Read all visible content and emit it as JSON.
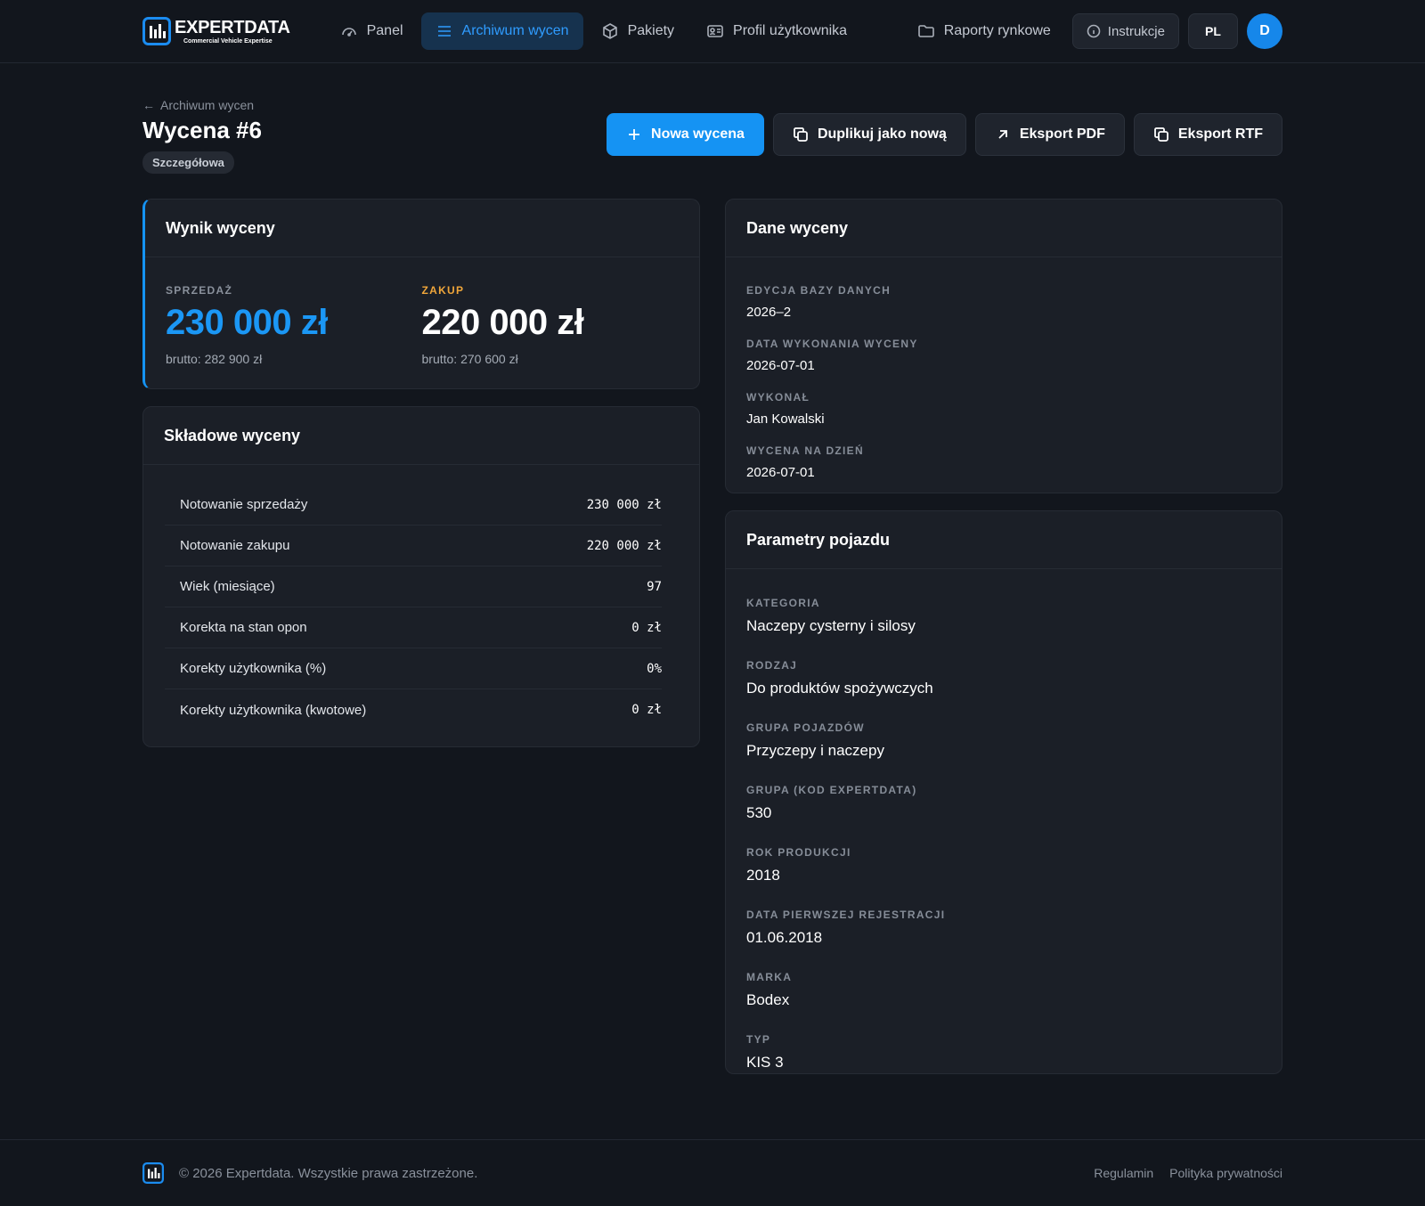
{
  "brand": {
    "name": "EXPERTDATA",
    "tagline": "Commercial Vehicle Expertise",
    "accent": "#1593f3"
  },
  "nav": {
    "items": [
      {
        "label": "Panel",
        "icon": "gauge-icon",
        "active": false
      },
      {
        "label": "Archiwum wycen",
        "icon": "menu-icon",
        "active": true
      },
      {
        "label": "Pakiety",
        "icon": "package-icon",
        "active": false
      },
      {
        "label": "Profil użytkownika",
        "icon": "id-card-icon",
        "active": false
      }
    ],
    "reports_label": "Raporty rynkowe",
    "instructions_label": "Instrukcje",
    "language": "PL",
    "avatar_initial": "D"
  },
  "header": {
    "back_label": "Archiwum wycen",
    "title": "Wycena #6",
    "badge": "Szczegółowa"
  },
  "actions": {
    "new_label": "Nowa wycena",
    "duplicate_label": "Duplikuj jako nową",
    "pdf_label": "Eksport PDF",
    "rtf_label": "Eksport RTF"
  },
  "result": {
    "title": "Wynik wyceny",
    "sale_label": "SPRZEDAŻ",
    "sale_value": "230 000 zł",
    "sale_gross": "brutto: 282 900 zł",
    "buy_label": "ZAKUP",
    "buy_value": "220 000 zł",
    "buy_gross": "brutto: 270 600 zł"
  },
  "components": {
    "title": "Składowe wyceny",
    "rows": [
      {
        "label": "Notowanie sprzedaży",
        "value": "230 000 zł"
      },
      {
        "label": "Notowanie zakupu",
        "value": "220 000 zł"
      },
      {
        "label": "Wiek (miesiące)",
        "value": "97"
      },
      {
        "label": "Korekta na stan opon",
        "value": "0 zł"
      },
      {
        "label": "Korekty użytkownika (%)",
        "value": "0%"
      },
      {
        "label": "Korekty użytkownika (kwotowe)",
        "value": "0 zł"
      }
    ]
  },
  "valuation_data": {
    "title": "Dane wyceny",
    "fields": [
      {
        "label": "EDYCJA BAZY DANYCH",
        "value": "2026–2"
      },
      {
        "label": "DATA WYKONANIA WYCENY",
        "value": "2026-07-01"
      },
      {
        "label": "WYKONAŁ",
        "value": "Jan Kowalski"
      },
      {
        "label": "WYCENA NA DZIEŃ",
        "value": "2026-07-01"
      }
    ]
  },
  "vehicle": {
    "title": "Parametry pojazdu",
    "fields": [
      {
        "label": "KATEGORIA",
        "value": "Naczepy cysterny i silosy"
      },
      {
        "label": "RODZAJ",
        "value": "Do produktów spożywczych"
      },
      {
        "label": "GRUPA POJAZDÓW",
        "value": "Przyczepy i naczepy"
      },
      {
        "label": "GRUPA (KOD EXPERTDATA)",
        "value": "530"
      },
      {
        "label": "ROK PRODUKCJI",
        "value": "2018"
      },
      {
        "label": "DATA PIERWSZEJ REJESTRACJI",
        "value": "01.06.2018"
      },
      {
        "label": "MARKA",
        "value": "Bodex"
      },
      {
        "label": "TYP",
        "value": "KIS 3"
      }
    ]
  },
  "footer": {
    "copyright": "© 2026 Expertdata. Wszystkie prawa zastrzeżone.",
    "terms_label": "Regulamin",
    "privacy_label": "Polityka prywatności"
  }
}
